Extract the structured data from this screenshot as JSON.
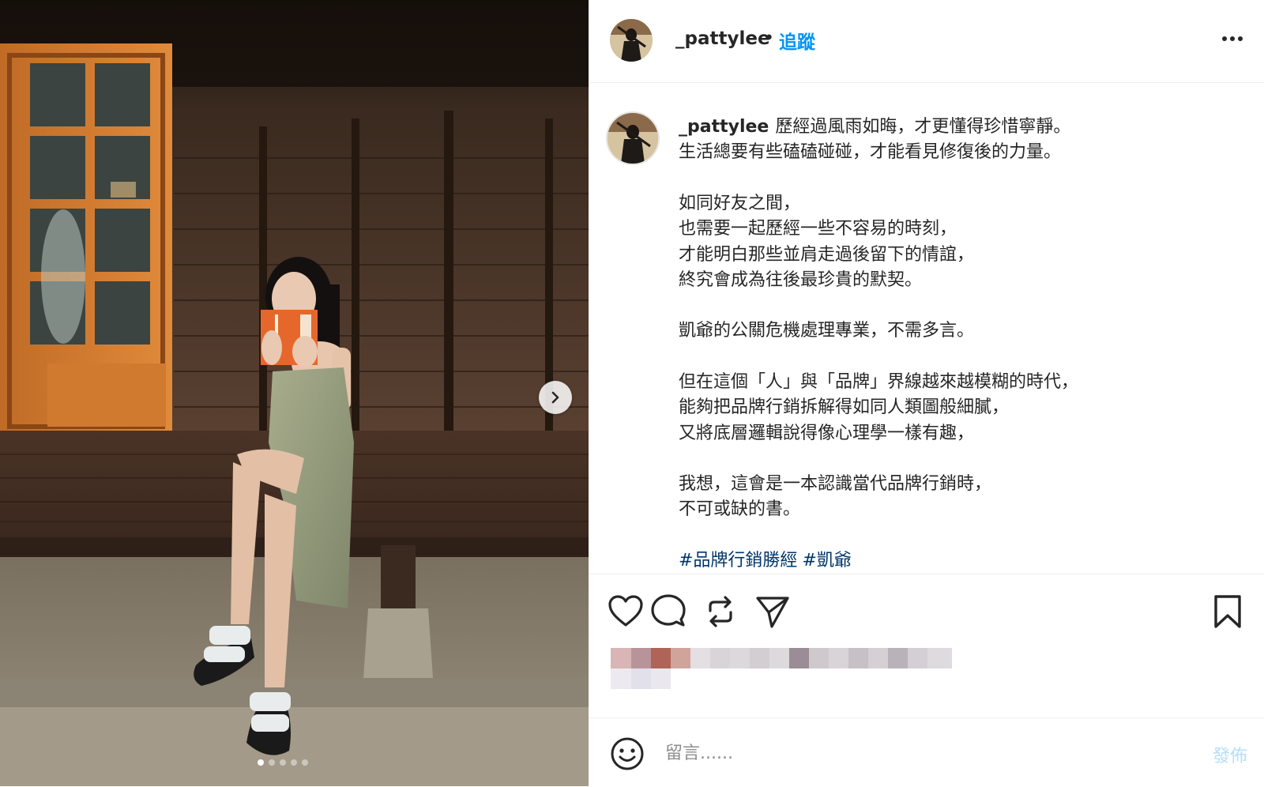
{
  "post": {
    "username": "_pattylee",
    "separator": "•",
    "follow_label": "追蹤",
    "more_icon": "more-horizontal-icon"
  },
  "caption": {
    "username": "_pattylee",
    "paragraphs": [
      [
        "歷經過風雨如晦，才更懂得珍惜寧靜。",
        "生活總要有些磕磕碰碰，才能看見修復後的力量。"
      ],
      [
        "如同好友之間，",
        "也需要一起歷經一些不容易的時刻，",
        "才能明白那些並肩走過後留下的情誼，",
        "終究會成為往後最珍貴的默契。"
      ],
      [
        "凱爺的公關危機處理專業，不需多言。"
      ],
      [
        "但在這個「人」與「品牌」界線越來越模糊的時代，",
        "能夠把品牌行銷拆解得如同人類圖般細膩，",
        "又將底層邏輯說得像心理學一樣有趣，"
      ],
      [
        "我想，這會是一本認識當代品牌行銷時，",
        "不可或缺的書。"
      ]
    ],
    "hashtags": [
      "#品牌行銷勝經",
      "#凱爺"
    ]
  },
  "carousel": {
    "slide_count": 5,
    "active_index": 0
  },
  "actions": {
    "like_icon": "heart-icon",
    "comment_icon": "comment-icon",
    "repost_icon": "repost-icon",
    "share_icon": "share-icon",
    "save_icon": "bookmark-icon"
  },
  "comment": {
    "placeholder": "留言......",
    "post_label": "發佈"
  },
  "colors": {
    "link_blue": "#0095f6",
    "hashtag": "#00376b",
    "post_disabled": "#b2dffc"
  }
}
